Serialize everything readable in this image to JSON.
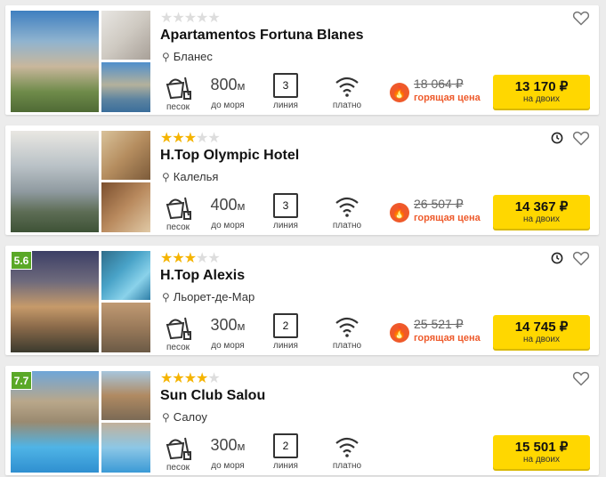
{
  "colors": {
    "star_on": "#f5b400",
    "star_off": "#dddddd",
    "button": "#ffd700",
    "hot": "#ee5a2b",
    "rating_badge": "#5aa827"
  },
  "icons": {
    "favorite": "heart-outline-icon",
    "timer": "clock-icon",
    "location": "map-pin-icon",
    "beach_type": "sand-bucket-icon",
    "wifi": "wifi-icon",
    "hot_price": "fire-icon"
  },
  "hotels": [
    {
      "name": "Apartamentos Fortuna Blanes",
      "stars": 0,
      "city": "Бланес",
      "rating": "",
      "beach_type": "песок",
      "distance_value": "800",
      "distance_unit": "м",
      "distance_label": "до моря",
      "line_value": "3",
      "line_label": "линия",
      "wifi_label": "платно",
      "old_price": "18 064 ₽",
      "hot_label": "горящая цена",
      "price": "13 170 ₽",
      "price_for": "на двоих",
      "has_clock": false
    },
    {
      "name": "H.Top Olympic Hotel",
      "stars": 3,
      "city": "Калелья",
      "rating": "",
      "beach_type": "песок",
      "distance_value": "400",
      "distance_unit": "м",
      "distance_label": "до моря",
      "line_value": "3",
      "line_label": "линия",
      "wifi_label": "платно",
      "old_price": "26 507 ₽",
      "hot_label": "горящая цена",
      "price": "14 367 ₽",
      "price_for": "на двоих",
      "has_clock": true
    },
    {
      "name": "H.Top Alexis",
      "stars": 3,
      "city": "Льорет-де-Мар",
      "rating": "5.6",
      "beach_type": "песок",
      "distance_value": "300",
      "distance_unit": "м",
      "distance_label": "до моря",
      "line_value": "2",
      "line_label": "линия",
      "wifi_label": "платно",
      "old_price": "25 521 ₽",
      "hot_label": "горящая цена",
      "price": "14 745 ₽",
      "price_for": "на двоих",
      "has_clock": true
    },
    {
      "name": "Sun Club Salou",
      "stars": 4,
      "city": "Салоу",
      "rating": "7.7",
      "beach_type": "песок",
      "distance_value": "300",
      "distance_unit": "м",
      "distance_label": "до моря",
      "line_value": "2",
      "line_label": "линия",
      "wifi_label": "платно",
      "old_price": "",
      "hot_label": "",
      "price": "15 501 ₽",
      "price_for": "на двоих",
      "has_clock": false
    }
  ]
}
